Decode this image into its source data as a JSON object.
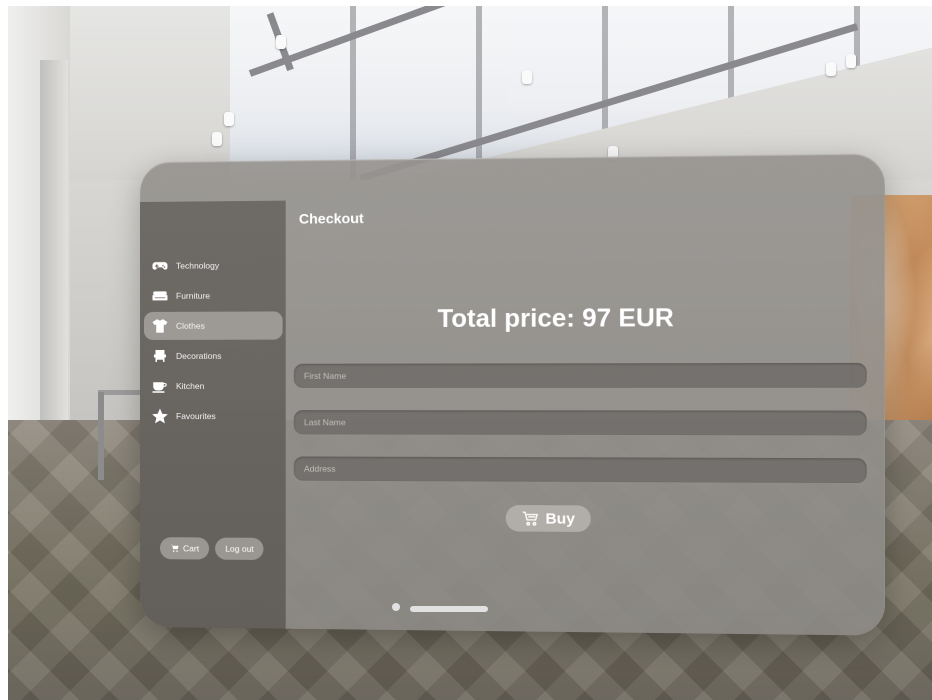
{
  "window": {
    "title": "Checkout"
  },
  "sidebar": {
    "items": [
      {
        "label": "Technology",
        "icon": "gamepad-icon",
        "active": false
      },
      {
        "label": "Furniture",
        "icon": "sofa-icon",
        "active": false
      },
      {
        "label": "Clothes",
        "icon": "tshirt-icon",
        "active": true
      },
      {
        "label": "Decorations",
        "icon": "decoration-icon",
        "active": false
      },
      {
        "label": "Kitchen",
        "icon": "mug-icon",
        "active": false
      },
      {
        "label": "Favourites",
        "icon": "star-icon",
        "active": false
      }
    ],
    "cart_label": "Cart",
    "logout_label": "Log out"
  },
  "checkout": {
    "total_text": "Total price: 97 EUR",
    "first_name_placeholder": "First Name",
    "last_name_placeholder": "Last Name",
    "address_placeholder": "Address",
    "buy_label": "Buy"
  },
  "colors": {
    "glass": "#96938f",
    "sidebar": "#69655f",
    "active_item": "#afaba7",
    "text": "#ffffff"
  }
}
